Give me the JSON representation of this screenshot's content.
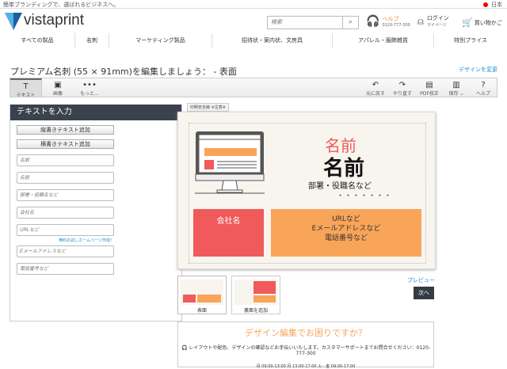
{
  "topbar": {
    "tagline": "簡単ブランディングで、選ばれるビジネスへ。",
    "country": "日本"
  },
  "header": {
    "logo": "vistaprint",
    "search_placeholder": "検索",
    "help_label": "ヘルプ",
    "help_phone": "0120-777-300",
    "login_label": "ログイン",
    "login_sub": "マイページ",
    "cart_label": "買い物かご"
  },
  "nav": [
    "すべての製品",
    "名刺",
    "マーケティング製品",
    "招待状・案内状、文房具",
    "アパレル・服飾雑貨",
    "特別プライス"
  ],
  "page": {
    "title": "プレミアム名刺 (55 × 91mm)を編集しましょう： - 表面",
    "change_design": "デザインを変更"
  },
  "toolbar": {
    "left": [
      {
        "icon": "T",
        "label": "テキスト"
      },
      {
        "icon": "▣",
        "label": "画像"
      },
      {
        "icon": "•••",
        "label": "もっと..."
      }
    ],
    "right": [
      {
        "icon": "↶",
        "label": "元に戻す"
      },
      {
        "icon": "↷",
        "label": "やり直す"
      },
      {
        "icon": "▤",
        "label": "PDF校正"
      },
      {
        "icon": "▥",
        "label": "保存 ⌄"
      },
      {
        "icon": "?",
        "label": "ヘルプ"
      }
    ]
  },
  "panel": {
    "title": "テキストを入力",
    "add_vertical": "縦書きテキスト追加",
    "add_horizontal": "横書きテキスト追加",
    "fields": [
      "名前",
      "名前",
      "部署・役職名など",
      "会社名",
      "URLなど",
      "Eメールアドレスなど",
      "電話番号など"
    ],
    "homepage_link": "無料お試しホームページ作成！"
  },
  "canvas": {
    "bleed_label": "印刷安全線 ※注意※",
    "name_red": "名前",
    "name": "名前",
    "dept": "部署・役職名など",
    "dots": "・・・・・・・",
    "company": "会社名",
    "url": "URLなど",
    "email": "Eメールアドレスなど",
    "phone": "電話番号など",
    "colors": {
      "red": "#f05a5a",
      "orange": "#f8a55a",
      "bg": "#f8f4ee"
    }
  },
  "thumbs": {
    "front": "表面",
    "add_back": "裏面を追加"
  },
  "actions": {
    "preview": "プレビュー",
    "next": "次へ"
  },
  "help": {
    "heading": "デザイン編集でお困りですか？",
    "message": "レイアウトや配色、デザインの確認などお手伝いいたします。カスタマーサポートまでお問合せください：0120-777-300",
    "hours": "月 09:00-13:00 月 13:00-17:00 火 - 金 09:00-17:00"
  }
}
